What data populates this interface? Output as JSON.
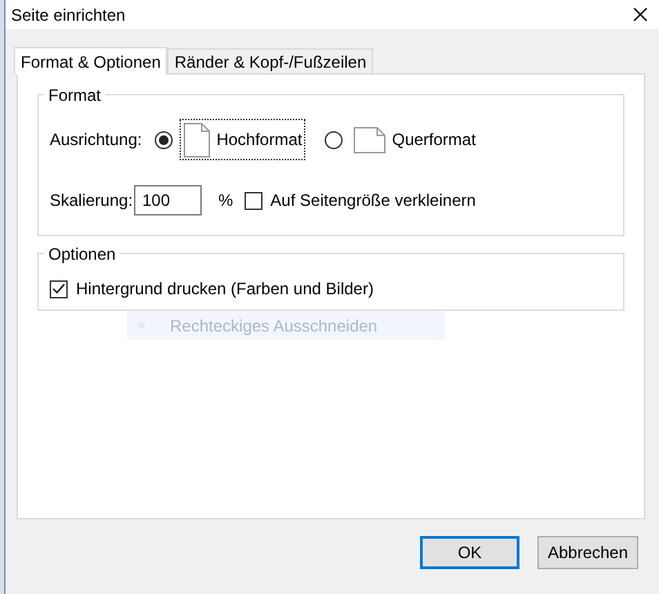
{
  "window": {
    "title": "Seite einrichten"
  },
  "tabs": [
    {
      "label": "Format & Optionen",
      "selected": true
    },
    {
      "label": "Ränder & Kopf-/Fußzeilen",
      "selected": false
    }
  ],
  "format": {
    "title": "Format",
    "orientation_label": "Ausrichtung:",
    "orientations": [
      {
        "label": "Hochformat",
        "selected": true,
        "kind": "portrait"
      },
      {
        "label": "Querformat",
        "selected": false,
        "kind": "landscape"
      }
    ],
    "scale_label": "Skalierung:",
    "scale_value": "100",
    "scale_unit": "%",
    "shrink": {
      "label": "Auf Seitengröße verkleinern",
      "checked": false
    }
  },
  "options": {
    "title": "Optionen",
    "items": [
      {
        "label": "Hintergrund drucken (Farben und Bilder)",
        "checked": true
      }
    ]
  },
  "ghost_item": {
    "label": "Rechteckiges Ausschneiden"
  },
  "buttons": [
    {
      "label": "OK",
      "default": true
    },
    {
      "label": "Abbrechen",
      "default": false
    }
  ]
}
